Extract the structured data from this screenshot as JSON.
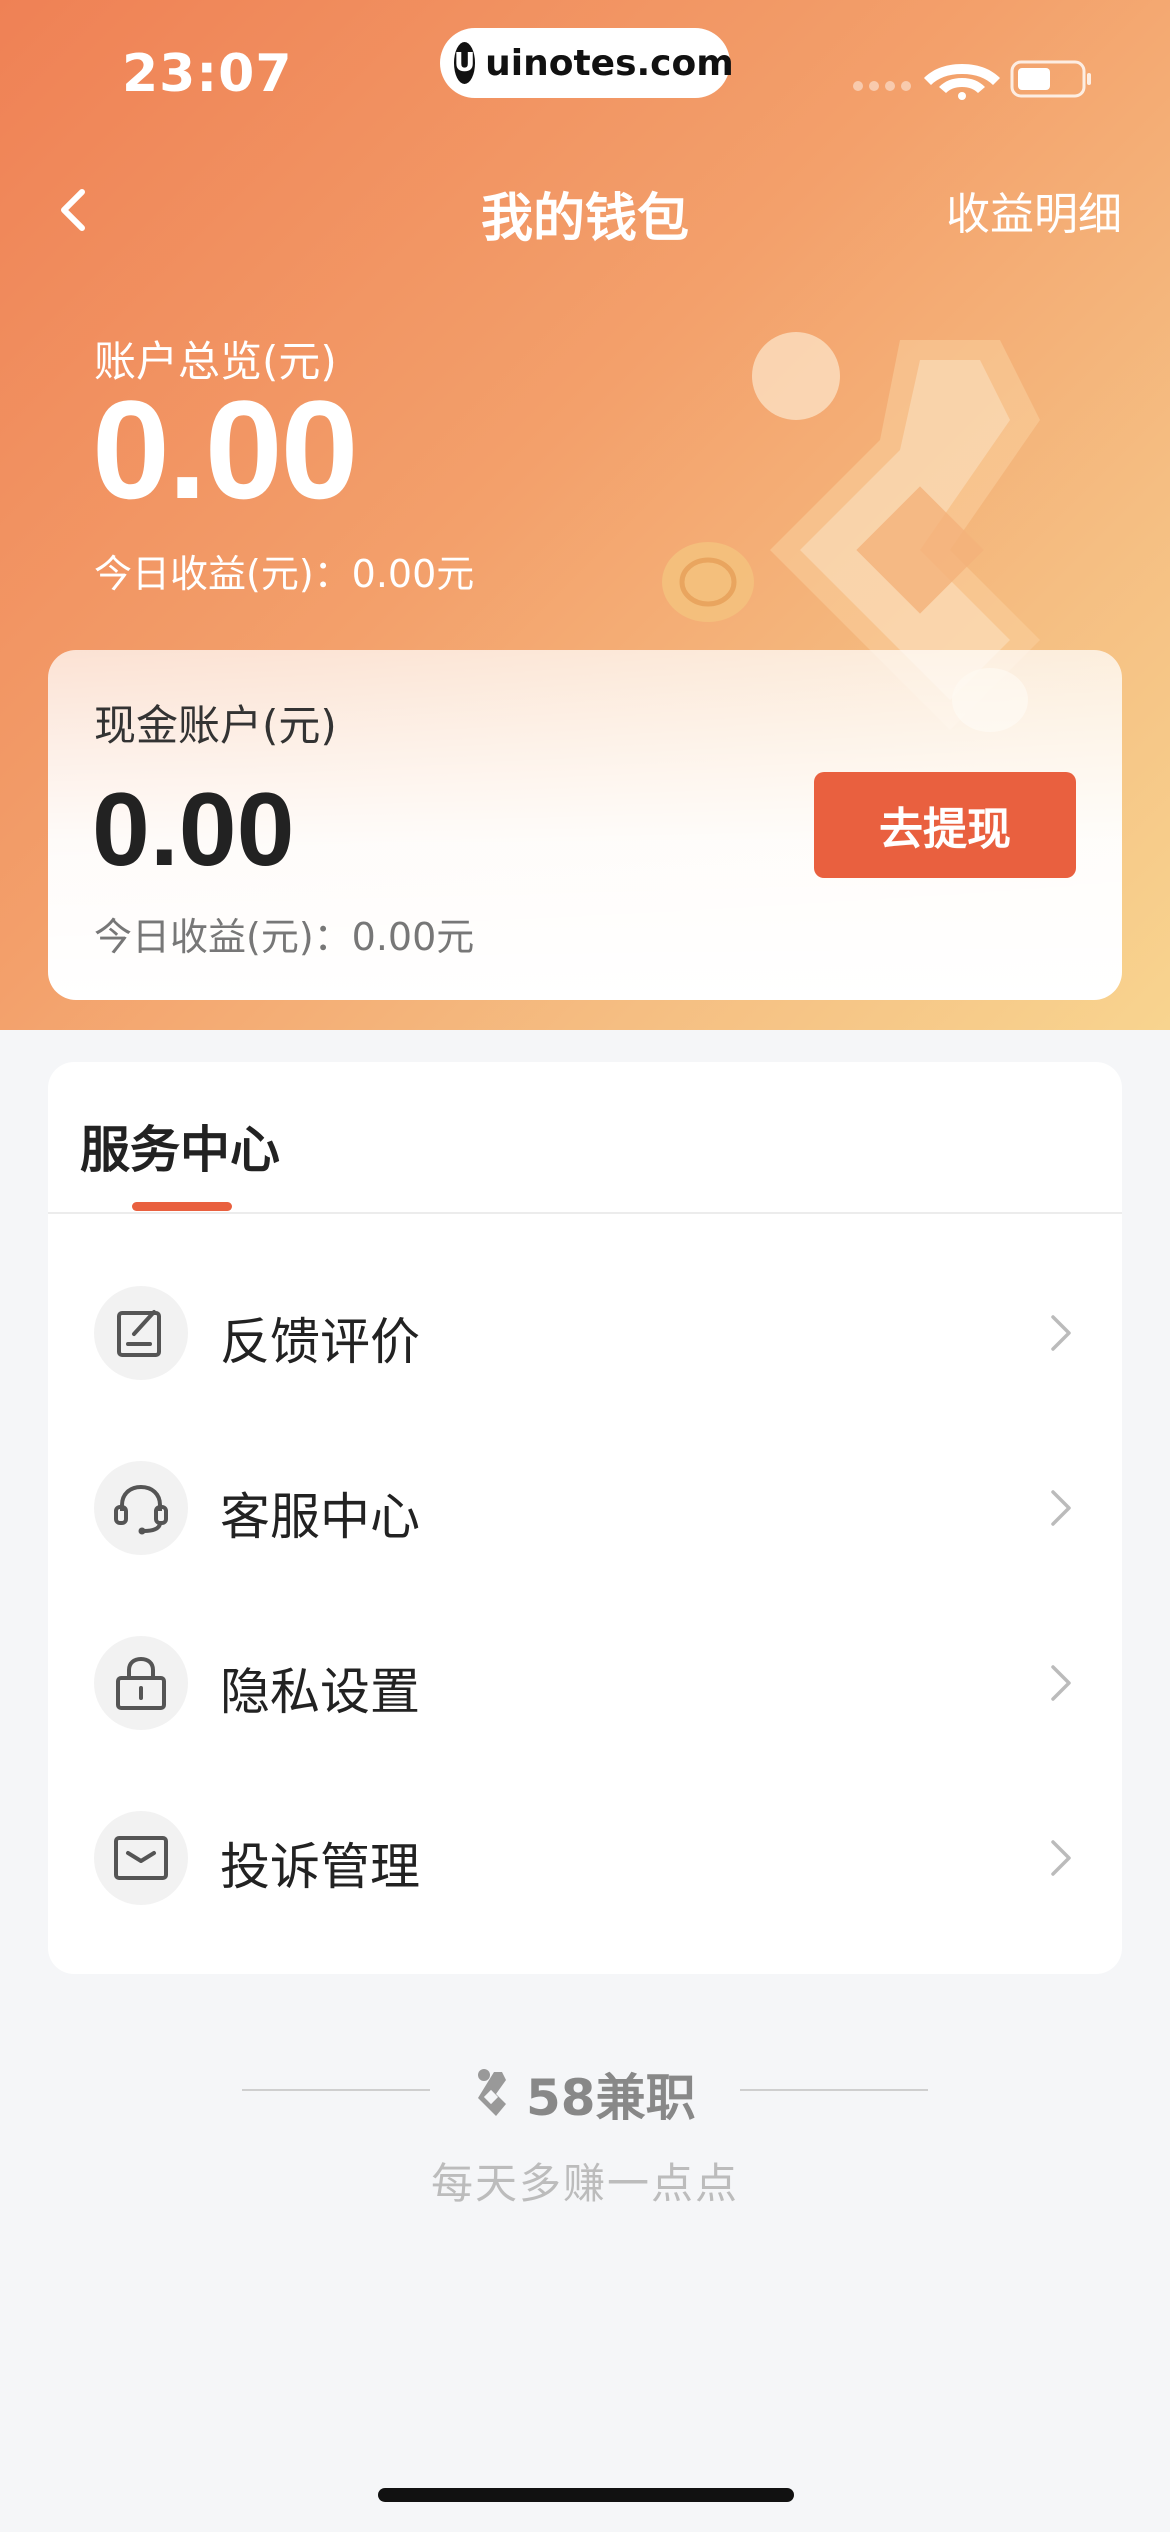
{
  "status": {
    "time": "23:07",
    "watermark": "uinotes.com"
  },
  "nav": {
    "title": "我的钱包",
    "right_label": "收益明细",
    "back_icon": "chevron-left-icon"
  },
  "total": {
    "label": "账户总览(元)",
    "value": "0.00",
    "today": "今日收益(元)：0.00元"
  },
  "cash": {
    "label": "现金账户(元)",
    "value": "0.00",
    "today": "今日收益(元)：0.00元",
    "button": "去提现"
  },
  "service": {
    "title": "服务中心",
    "items": [
      {
        "label": "反馈评价",
        "icon": "feedback-edit-icon"
      },
      {
        "label": "客服中心",
        "icon": "headset-icon"
      },
      {
        "label": "隐私设置",
        "icon": "lock-icon"
      },
      {
        "label": "投诉管理",
        "icon": "envelope-icon"
      }
    ]
  },
  "footer": {
    "brand": "58兼职",
    "slogan": "每天多赚一点点"
  },
  "colors": {
    "accent": "#e9603f",
    "hero_start": "#ef8155",
    "hero_end": "#f8d48f"
  }
}
